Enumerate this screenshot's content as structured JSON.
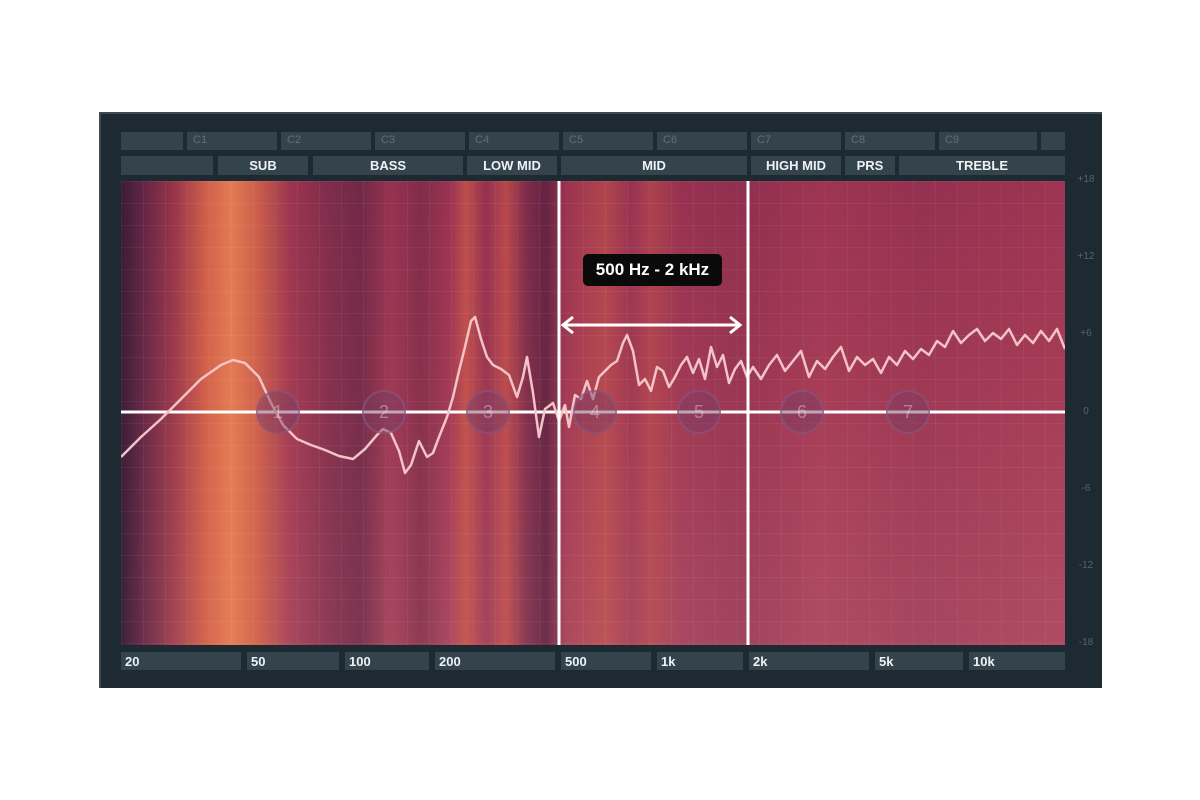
{
  "notes": [
    "",
    "C1",
    "C2",
    "C3",
    "C4",
    "C5",
    "C6",
    "C7",
    "C8",
    "C9",
    ""
  ],
  "bands": [
    "",
    "SUB",
    "BASS",
    "LOW MID",
    "MID",
    "HIGH MID",
    "PRS",
    "TREBLE"
  ],
  "freq_labels": [
    "20",
    "50",
    "100",
    "200",
    "500",
    "1k",
    "2k",
    "5k",
    "10k"
  ],
  "db_labels": [
    "+18",
    "+12",
    "+6",
    "0",
    "-6",
    "-12",
    "-18"
  ],
  "eq_nodes": [
    "1",
    "2",
    "3",
    "4",
    "5",
    "6",
    "7"
  ],
  "range_label": "500 Hz - 2 kHz",
  "colors": {
    "panel": "#1d2a31",
    "label_bg": "#34444d",
    "curve": "#f2c3c7",
    "marker": "#ffffff"
  }
}
